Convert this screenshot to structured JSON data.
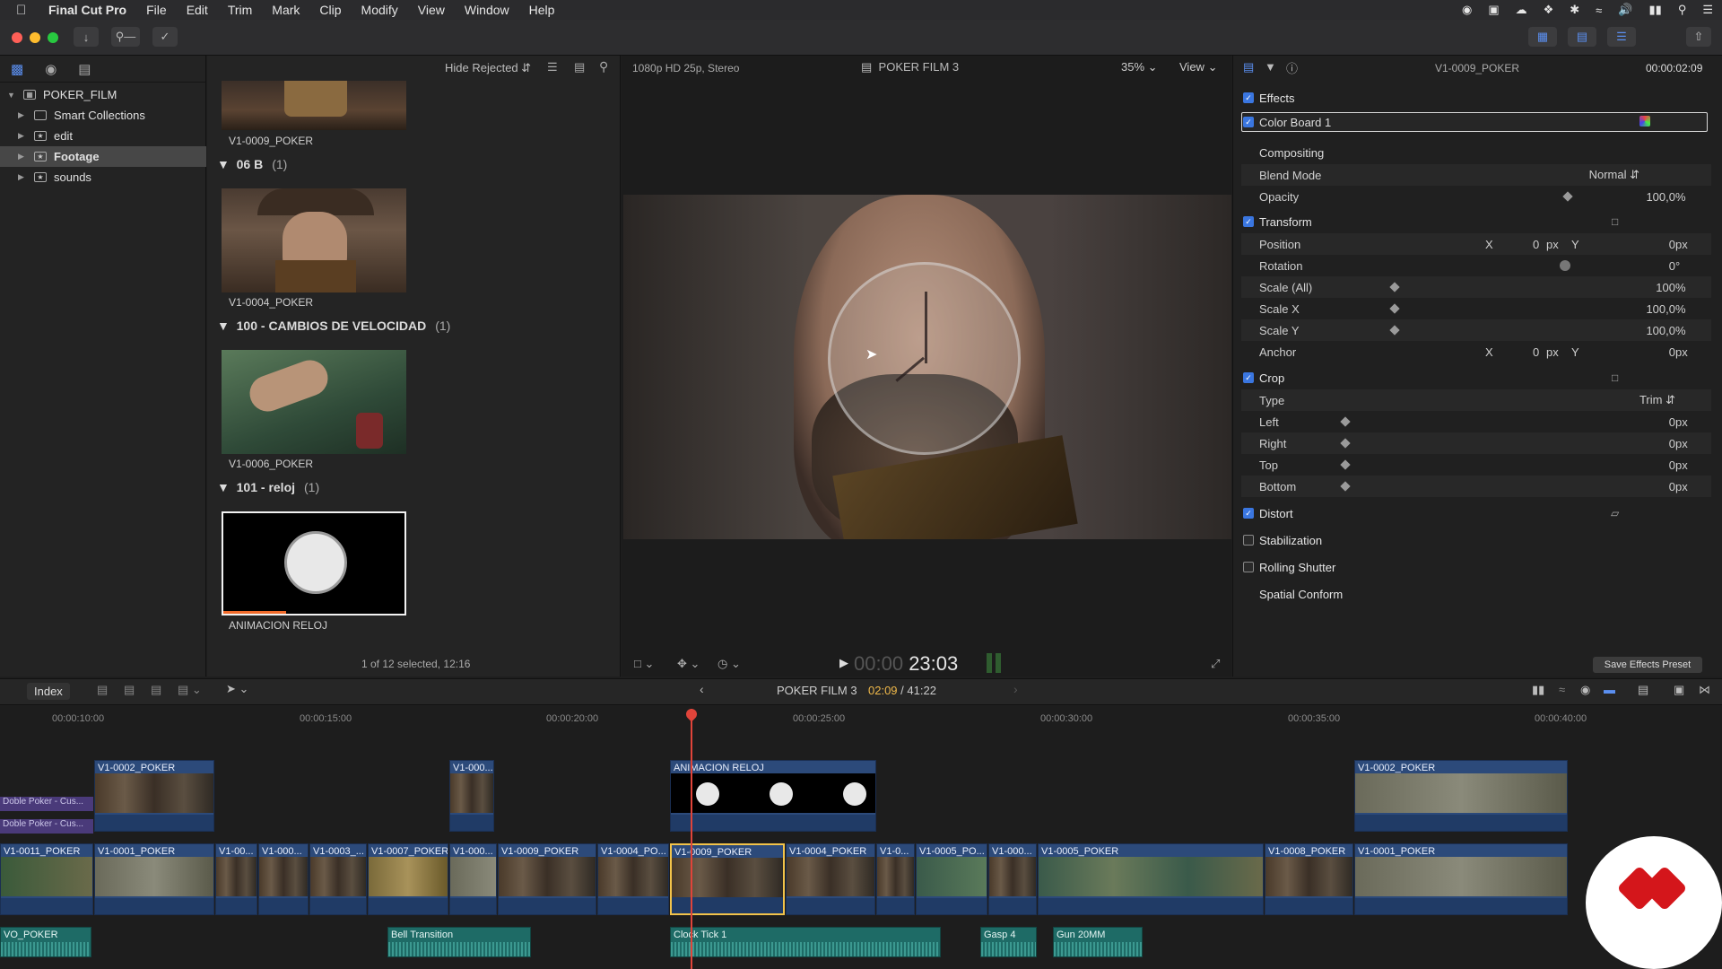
{
  "menubar": {
    "app": "Final Cut Pro",
    "items": [
      "File",
      "Edit",
      "Trim",
      "Mark",
      "Clip",
      "Modify",
      "View",
      "Window",
      "Help"
    ]
  },
  "library": {
    "root": "POKER_FILM",
    "items": [
      "Smart Collections",
      "edit",
      "Footage",
      "sounds"
    ],
    "selected": "Footage"
  },
  "browser": {
    "filter": "Hide Rejected",
    "groups": [
      {
        "title": "06 B",
        "count": "(1)",
        "clip": "V1-0004_POKER"
      },
      {
        "title": "100 - CAMBIOS DE VELOCIDAD",
        "count": "(1)",
        "clip": "V1-0006_POKER"
      },
      {
        "title": "101 - reloj",
        "count": "(1)",
        "clip": "ANIMACION RELOJ"
      }
    ],
    "top_clip": "V1-0009_POKER",
    "status": "1 of 12 selected, 12:16"
  },
  "viewer": {
    "format": "1080p HD 25p, Stereo",
    "title": "POKER FILM 3",
    "zoom": "35%",
    "view": "View",
    "timecode_dim": "00:00",
    "timecode": "23:03"
  },
  "inspector": {
    "clip_name": "V1-0009_POKER",
    "duration": "00:00:02:09",
    "effects": "Effects",
    "color_board": "Color Board 1",
    "compositing": "Compositing",
    "blend_mode_label": "Blend Mode",
    "blend_mode": "Normal",
    "opacity_label": "Opacity",
    "opacity": "100,0",
    "transform": "Transform",
    "position_label": "Position",
    "rotation_label": "Rotation",
    "rotation": "0",
    "scale_all_label": "Scale (All)",
    "scale_all": "100",
    "scale_x_label": "Scale X",
    "scale_x": "100,0",
    "scale_y_label": "Scale Y",
    "scale_y": "100,0",
    "anchor_label": "Anchor",
    "crop": "Crop",
    "type_label": "Type",
    "type": "Trim",
    "left_label": "Left",
    "right_label": "Right",
    "top_label": "Top",
    "bottom_label": "Bottom",
    "zero": "0",
    "x": "X",
    "y": "Y",
    "px": "px",
    "pct": "%",
    "deg": "°",
    "distort": "Distort",
    "stabilization": "Stabilization",
    "rolling_shutter": "Rolling Shutter",
    "spatial_conform": "Spatial Conform",
    "save_preset": "Save Effects Preset"
  },
  "timeline": {
    "index": "Index",
    "project": "POKER FILM 3",
    "position": "02:09",
    "total": "/ 41:22",
    "ruler": [
      "00:00:10:00",
      "00:00:15:00",
      "00:00:20:00",
      "00:00:25:00",
      "00:00:30:00",
      "00:00:35:00",
      "00:00:40:00"
    ],
    "connected": [
      "V1-0002_POKER",
      "V1-000...",
      "ANIMACION RELOJ",
      "V1-0002_POKER"
    ],
    "left_labels": [
      "Doble Poker - Cus...",
      "Doble Poker - Cus..."
    ],
    "primary": [
      "V1-0011_POKER",
      "V1-0001_POKER",
      "V1-00...",
      "V1-000...",
      "V1-0003_...",
      "V1-0007_POKER",
      "V1-000...",
      "V1-0009_POKER",
      "V1-0004_PO...",
      "V1-0009_POKER",
      "V1-0004_POKER",
      "V1-0...",
      "V1-0005_PO...",
      "V1-000...",
      "V1-0005_POKER",
      "V1-0008_POKER",
      "V1-0001_POKER"
    ],
    "audio": [
      "VO_POKER",
      "Bell Transition",
      "Clock Tick 1",
      "Gasp 4",
      "Gun 20MM"
    ]
  }
}
